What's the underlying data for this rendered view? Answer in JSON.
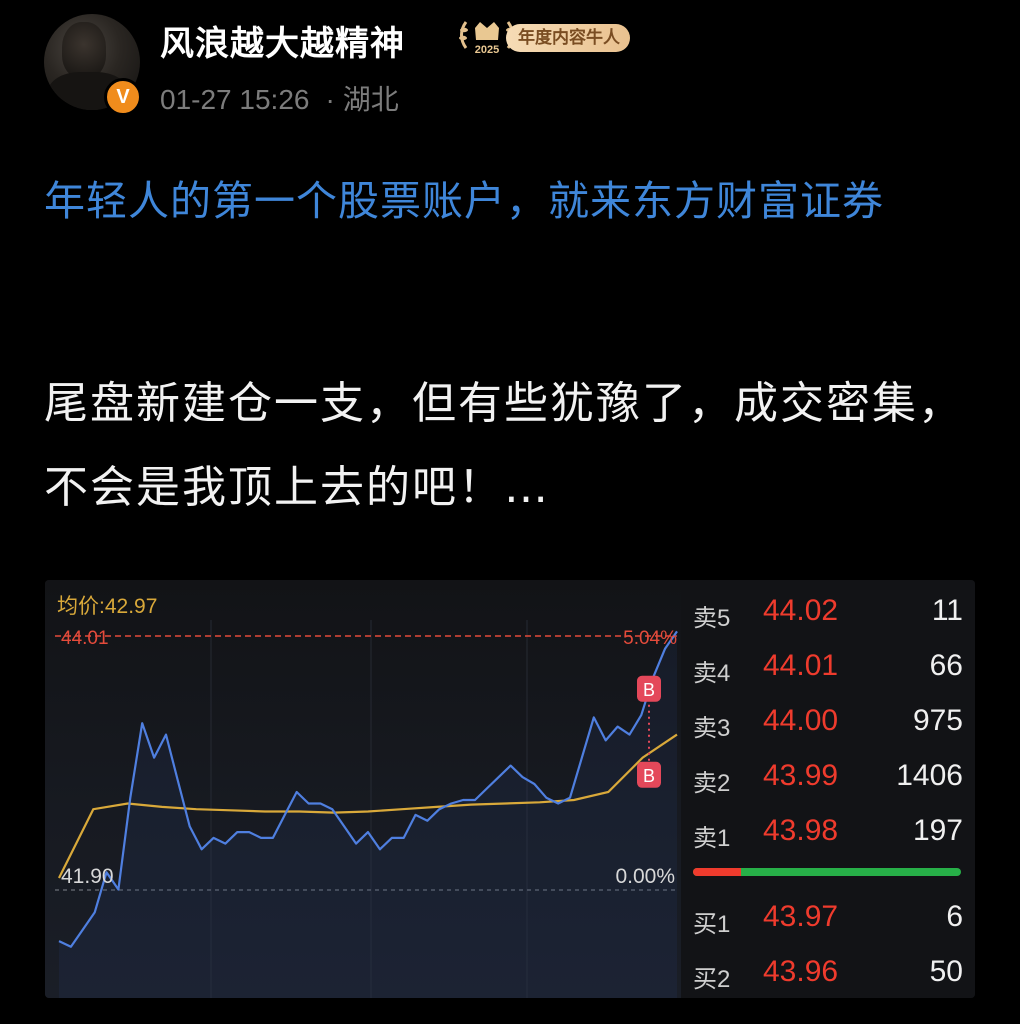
{
  "post": {
    "author": "风浪越大越精神",
    "verified_badge": "V",
    "award": {
      "year": "2025",
      "label": "年度内容牛人"
    },
    "date": "01-27 15:26",
    "separator": "·",
    "location": "湖北",
    "promo_link": "年轻人的第一个股票账户，就来东方财富证券",
    "body": "尾盘新建仓一支，但有些犹豫了，成交密集，不会是我顶上去的吧！…"
  },
  "stock": {
    "avg_price_label": "均价:42.97",
    "avg_price": 42.97,
    "high_price_label": "44.01",
    "high_pct_label": "5.04%",
    "base_price_label": "41.90",
    "base_pct_label": "0.00%",
    "buy_marker": "B",
    "colors": {
      "price_line": "#4f7fe0",
      "avg_line": "#d9a93a",
      "up": "#ef3b2d",
      "down": "#27b048"
    },
    "order_book": {
      "asks": [
        {
          "label": "卖5",
          "price": "44.02",
          "volume": "11"
        },
        {
          "label": "卖4",
          "price": "44.01",
          "volume": "66"
        },
        {
          "label": "卖3",
          "price": "44.00",
          "volume": "975"
        },
        {
          "label": "卖2",
          "price": "43.99",
          "volume": "1406"
        },
        {
          "label": "卖1",
          "price": "43.98",
          "volume": "197"
        }
      ],
      "bids": [
        {
          "label": "买1",
          "price": "43.97",
          "volume": "6"
        },
        {
          "label": "买2",
          "price": "43.96",
          "volume": "50"
        }
      ],
      "sell_ratio": 0.18
    }
  },
  "chart_data": {
    "type": "line",
    "title": "",
    "xlabel": "",
    "ylabel": "",
    "ylim": [
      41.9,
      44.01
    ],
    "y_right_labels": [
      "5.04%",
      "0.00%"
    ],
    "series": [
      {
        "name": "",
        "values": [
          41.35,
          41.3,
          41.45,
          41.6,
          41.95,
          41.8,
          42.6,
          43.25,
          42.95,
          43.15,
          42.75,
          42.35,
          42.15,
          42.25,
          42.2,
          42.3,
          42.3,
          42.25,
          42.25,
          42.45,
          42.65,
          42.55,
          42.55,
          42.5,
          42.35,
          42.2,
          42.3,
          42.15,
          42.25,
          42.25,
          42.45,
          42.4,
          42.5,
          42.55,
          42.58,
          42.58,
          42.68,
          42.78,
          42.88,
          42.78,
          42.72,
          42.6,
          42.55,
          42.6,
          42.95,
          43.3,
          43.1,
          43.22,
          43.15,
          43.32,
          43.65,
          43.9,
          44.05
        ]
      },
      {
        "name": "",
        "values": [
          41.9,
          42.5,
          42.55,
          42.52,
          42.5,
          42.49,
          42.48,
          42.48,
          42.47,
          42.48,
          42.5,
          42.52,
          42.54,
          42.55,
          42.56,
          42.58,
          42.65,
          42.95,
          43.15
        ]
      }
    ],
    "markers": [
      {
        "label": "B",
        "value": 42.8
      },
      {
        "label": "B",
        "value": 43.55
      }
    ],
    "reference_line": {
      "value": 44.01,
      "label": "44.01"
    }
  }
}
